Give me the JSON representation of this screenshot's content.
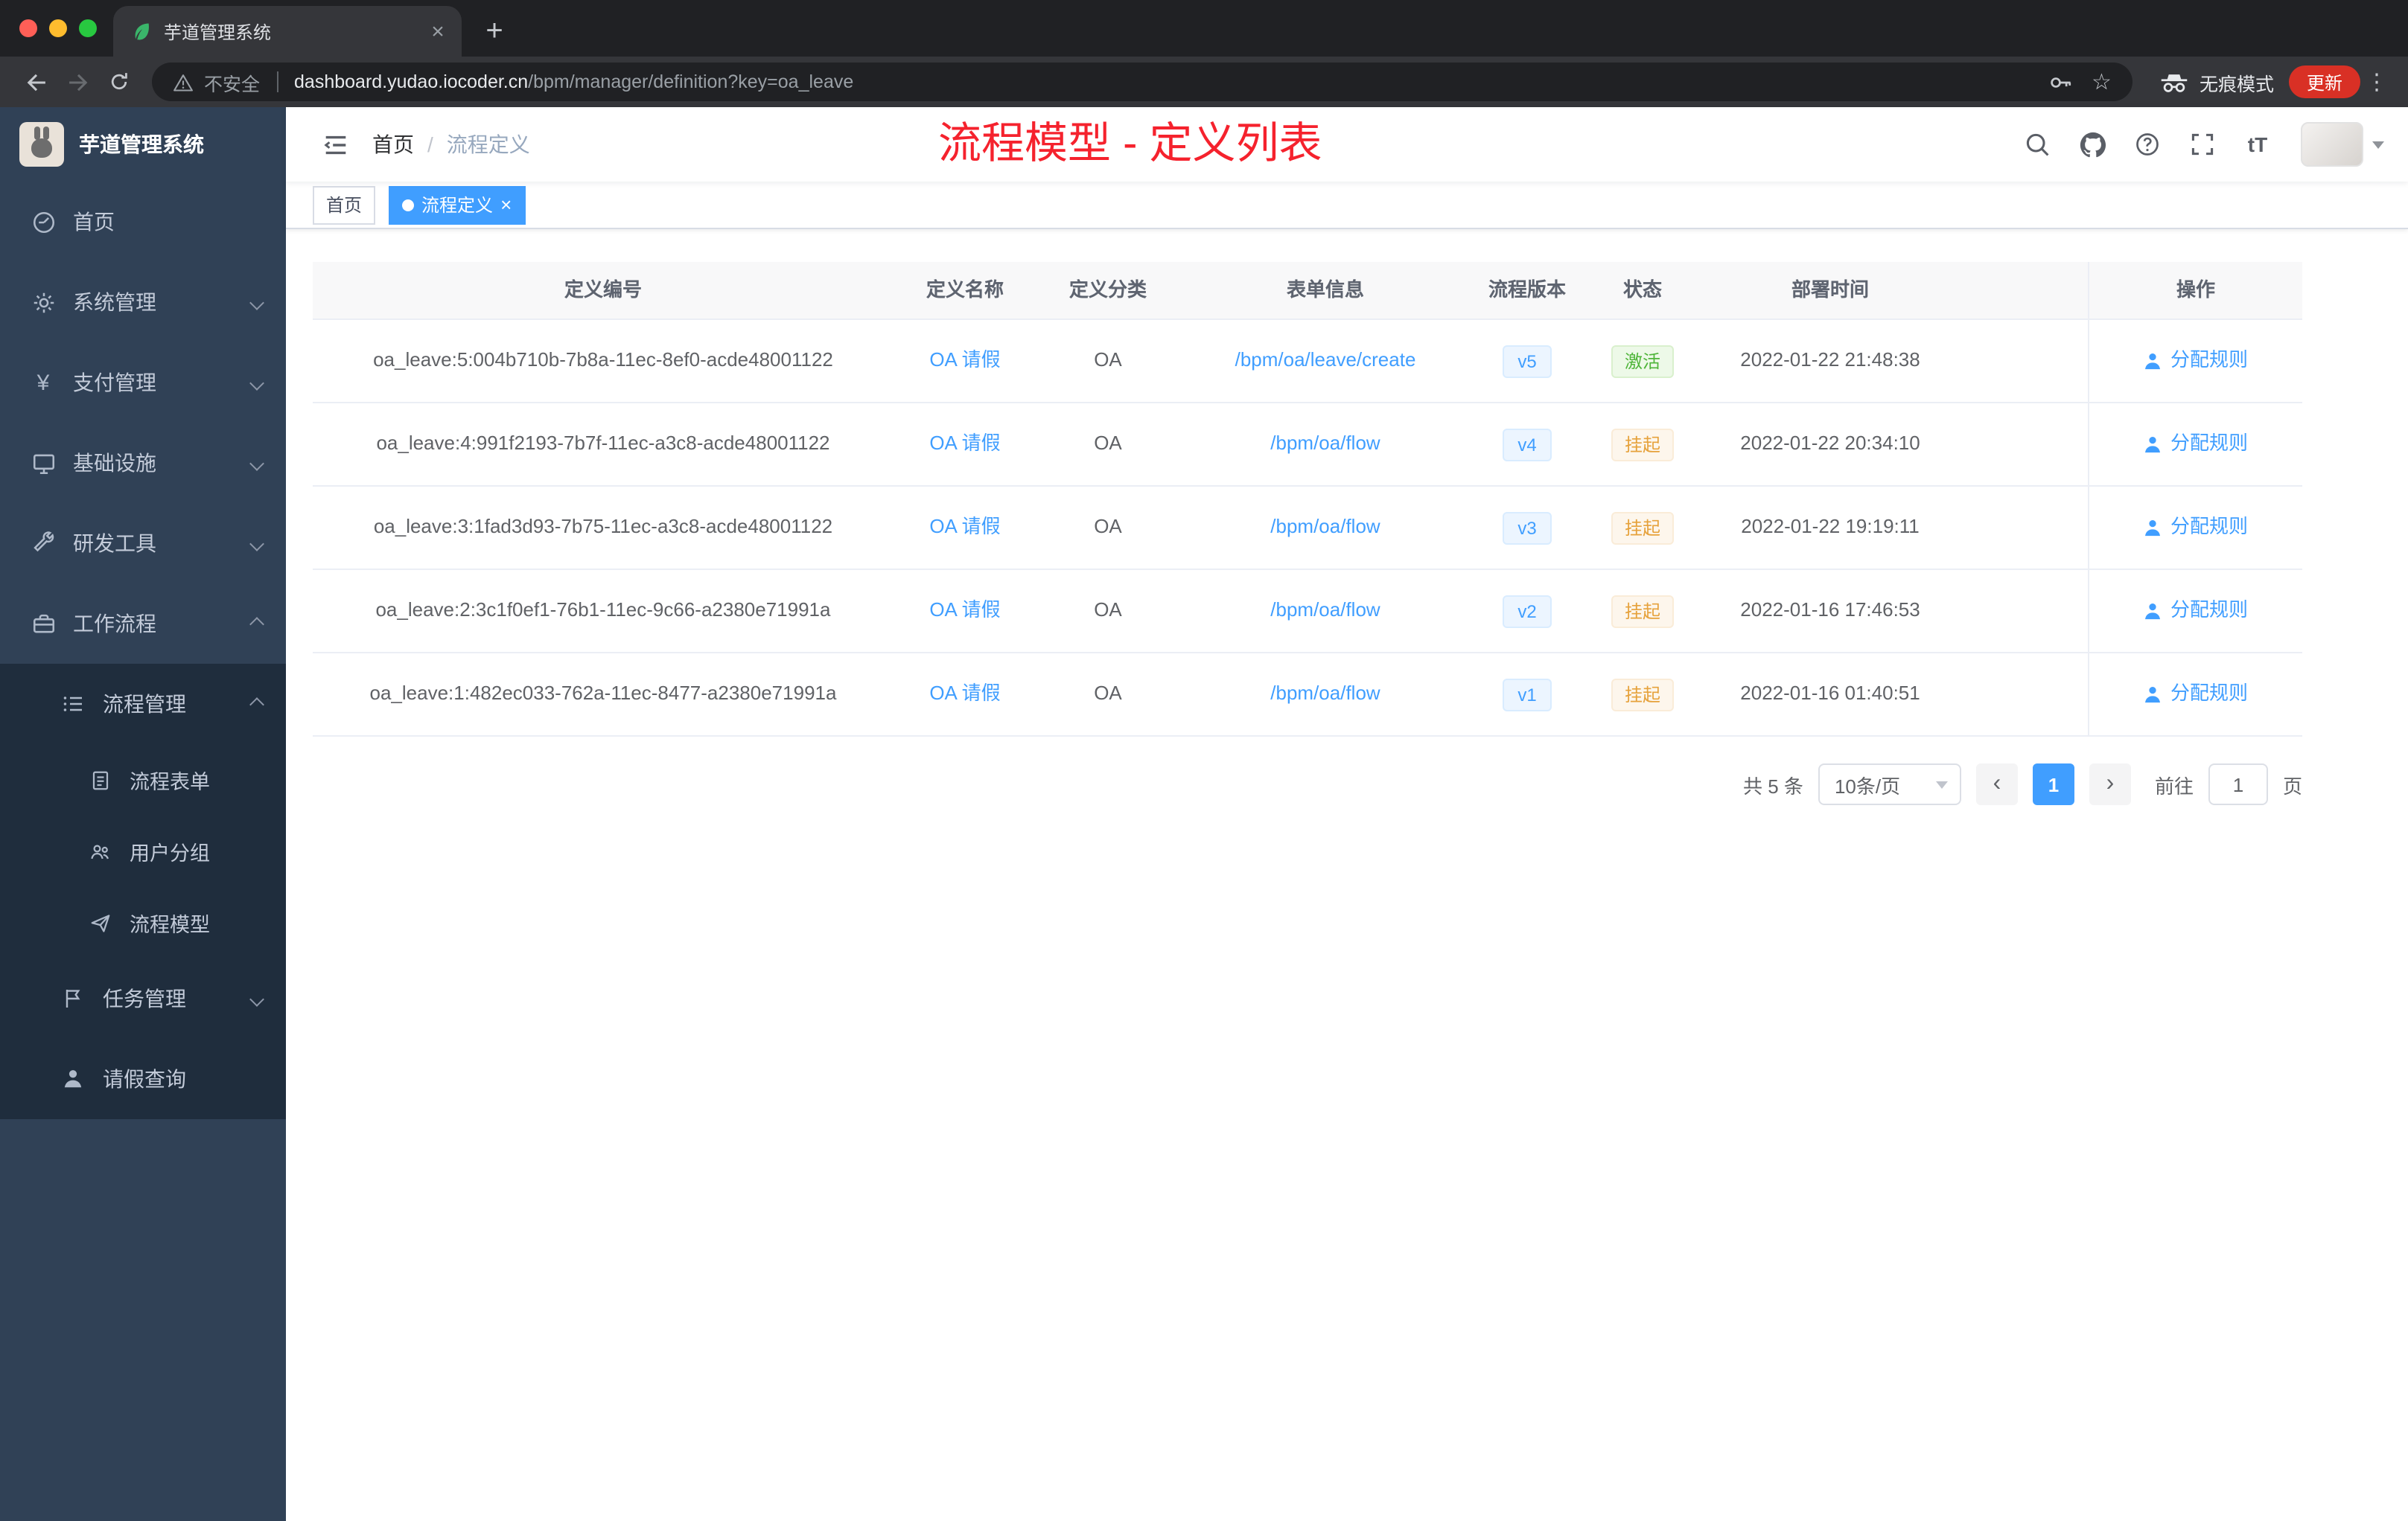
{
  "colors": {
    "accent": "#409eff",
    "success": "#67c23a",
    "warning": "#e6a23c",
    "annotation_red": "#f5222d",
    "sidebar_bg": "#304156",
    "submenu_bg": "#1f2d3d"
  },
  "icons": {
    "tab_favicon": "leaf-icon",
    "omnibox": [
      "warning-triangle-icon",
      "key-icon",
      "star-icon"
    ],
    "toolbar": [
      "back-icon",
      "forward-icon",
      "reload-icon",
      "incognito-spy-icon",
      "kebab-menu-icon"
    ],
    "header_right": [
      "search-icon",
      "github-icon",
      "question-icon",
      "fullscreen-icon",
      "font-size-icon",
      "chevron-down-icon"
    ],
    "sidebar": [
      "dashboard-icon",
      "gear-icon",
      "yen-icon",
      "monitor-icon",
      "wrench-icon",
      "briefcase-icon",
      "list-icon",
      "form-icon",
      "user-group-icon",
      "paper-plane-icon",
      "flag-icon",
      "user-icon"
    ],
    "action_link": "user-icon"
  },
  "browser": {
    "tab_title": "芋道管理系统",
    "security_label": "不安全",
    "url_host": "dashboard.yudao.iocoder.cn",
    "url_path": "/bpm/manager/definition?key=oa_leave",
    "incognito_label": "无痕模式",
    "update_label": "更新"
  },
  "sidebar": {
    "logo_title": "芋道管理系统",
    "items": [
      {
        "label": "首页"
      },
      {
        "label": "系统管理"
      },
      {
        "label": "支付管理"
      },
      {
        "label": "基础设施"
      },
      {
        "label": "研发工具"
      },
      {
        "label": "工作流程"
      }
    ],
    "workflow_children": {
      "process_mgmt": {
        "label": "流程管理",
        "children": [
          {
            "label": "流程表单"
          },
          {
            "label": "用户分组"
          },
          {
            "label": "流程模型"
          }
        ]
      },
      "task_mgmt": {
        "label": "任务管理"
      },
      "leave_query": {
        "label": "请假查询"
      }
    }
  },
  "header": {
    "breadcrumb": {
      "home": "首页",
      "separator": "/",
      "current": "流程定义"
    },
    "annotation": "流程模型 - 定义列表"
  },
  "tags": {
    "home": "首页",
    "active": "流程定义"
  },
  "table": {
    "columns": {
      "id": "定义编号",
      "name": "定义名称",
      "category": "定义分类",
      "form": "表单信息",
      "version": "流程版本",
      "status": "状态",
      "deploy_time": "部署时间",
      "action": "操作"
    },
    "rows": [
      {
        "id": "oa_leave:5:004b710b-7b8a-11ec-8ef0-acde48001122",
        "name": "OA 请假",
        "category": "OA",
        "form": "/bpm/oa/leave/create",
        "version": "v5",
        "status": "激活",
        "status_type": "success",
        "deploy_time": "2022-01-22 21:48:38",
        "action": "分配规则"
      },
      {
        "id": "oa_leave:4:991f2193-7b7f-11ec-a3c8-acde48001122",
        "name": "OA 请假",
        "category": "OA",
        "form": "/bpm/oa/flow",
        "version": "v4",
        "status": "挂起",
        "status_type": "warning",
        "deploy_time": "2022-01-22 20:34:10",
        "action": "分配规则"
      },
      {
        "id": "oa_leave:3:1fad3d93-7b75-11ec-a3c8-acde48001122",
        "name": "OA 请假",
        "category": "OA",
        "form": "/bpm/oa/flow",
        "version": "v3",
        "status": "挂起",
        "status_type": "warning",
        "deploy_time": "2022-01-22 19:19:11",
        "action": "分配规则"
      },
      {
        "id": "oa_leave:2:3c1f0ef1-76b1-11ec-9c66-a2380e71991a",
        "name": "OA 请假",
        "category": "OA",
        "form": "/bpm/oa/flow",
        "version": "v2",
        "status": "挂起",
        "status_type": "warning",
        "deploy_time": "2022-01-16 17:46:53",
        "action": "分配规则"
      },
      {
        "id": "oa_leave:1:482ec033-762a-11ec-8477-a2380e71991a",
        "name": "OA 请假",
        "category": "OA",
        "form": "/bpm/oa/flow",
        "version": "v1",
        "status": "挂起",
        "status_type": "warning",
        "deploy_time": "2022-01-16 01:40:51",
        "action": "分配规则"
      }
    ]
  },
  "pagination": {
    "total": "共 5 条",
    "page_size": "10条/页",
    "current_page": "1",
    "goto_label": "前往",
    "goto_value": "1",
    "goto_unit": "页"
  }
}
